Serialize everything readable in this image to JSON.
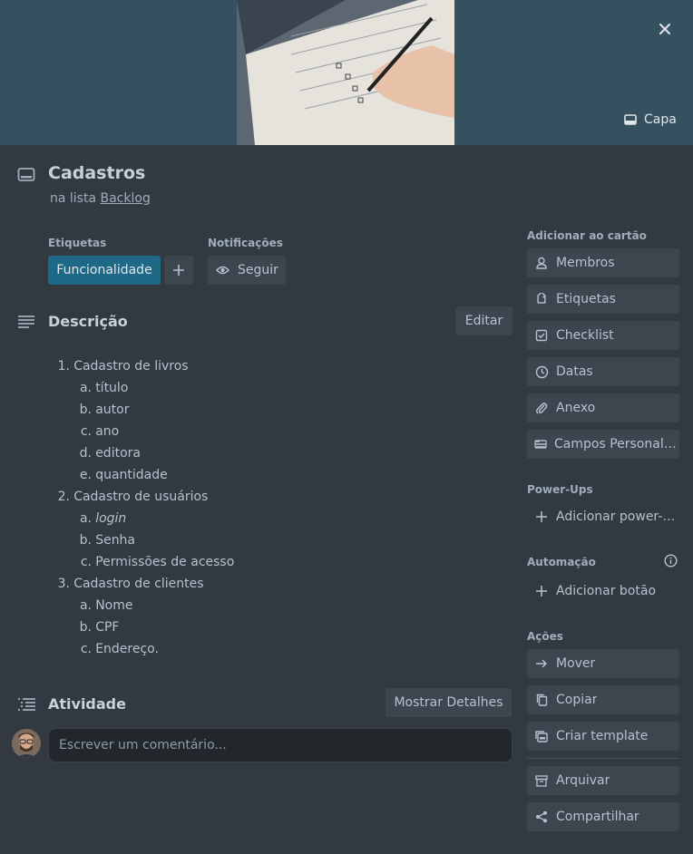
{
  "cover": {
    "button_label": "Capa"
  },
  "card": {
    "title": "Cadastros",
    "in_list_prefix": "na lista",
    "list_name": "Backlog"
  },
  "labels": {
    "heading": "Etiquetas",
    "items": [
      "Funcionalidade"
    ]
  },
  "notifications": {
    "heading": "Notificações",
    "follow_label": "Seguir"
  },
  "description": {
    "heading": "Descrição",
    "edit_label": "Editar",
    "items": [
      {
        "marker": "1.",
        "text": "Cadastro de livros",
        "level": 1
      },
      {
        "marker": "a.",
        "text": "título",
        "level": 2
      },
      {
        "marker": "b.",
        "text": "autor",
        "level": 2
      },
      {
        "marker": "c.",
        "text": "ano",
        "level": 2
      },
      {
        "marker": "d.",
        "text": "editora",
        "level": 2
      },
      {
        "marker": "e.",
        "text": "quantidade",
        "level": 2
      },
      {
        "marker": "2.",
        "text": "Cadastro de usuários",
        "level": 1
      },
      {
        "marker": "a.",
        "text": "login",
        "level": 2,
        "italic": true
      },
      {
        "marker": "b.",
        "text": "Senha",
        "level": 2
      },
      {
        "marker": "c.",
        "text": "Permissões de acesso",
        "level": 2
      },
      {
        "marker": "3.",
        "text": "Cadastro de clientes",
        "level": 1
      },
      {
        "marker": "a.",
        "text": "Nome",
        "level": 2
      },
      {
        "marker": "b.",
        "text": "CPF",
        "level": 2
      },
      {
        "marker": "c.",
        "text": "Endereço.",
        "level": 2
      }
    ]
  },
  "activity": {
    "heading": "Atividade",
    "show_details_label": "Mostrar Detalhes",
    "comment_placeholder": "Escrever um comentário..."
  },
  "sidebar": {
    "add_to_card": {
      "heading": "Adicionar ao cartão",
      "items": [
        {
          "label": "Membros",
          "icon": "person-icon"
        },
        {
          "label": "Etiquetas",
          "icon": "tag-icon"
        },
        {
          "label": "Checklist",
          "icon": "checkbox-icon"
        },
        {
          "label": "Datas",
          "icon": "clock-icon"
        },
        {
          "label": "Anexo",
          "icon": "paperclip-icon"
        },
        {
          "label": "Campos Personalizados",
          "icon": "custom-fields-icon"
        }
      ]
    },
    "powerups": {
      "heading": "Power-Ups",
      "add_label": "Adicionar power-ups"
    },
    "automation": {
      "heading": "Automação",
      "add_label": "Adicionar botão"
    },
    "actions": {
      "heading": "Ações",
      "items": [
        {
          "label": "Mover",
          "icon": "arrow-right-icon"
        },
        {
          "label": "Copiar",
          "icon": "copy-icon"
        },
        {
          "label": "Criar template",
          "icon": "template-icon"
        },
        {
          "label": "Arquivar",
          "icon": "archive-icon"
        },
        {
          "label": "Compartilhar",
          "icon": "share-icon"
        }
      ]
    }
  }
}
